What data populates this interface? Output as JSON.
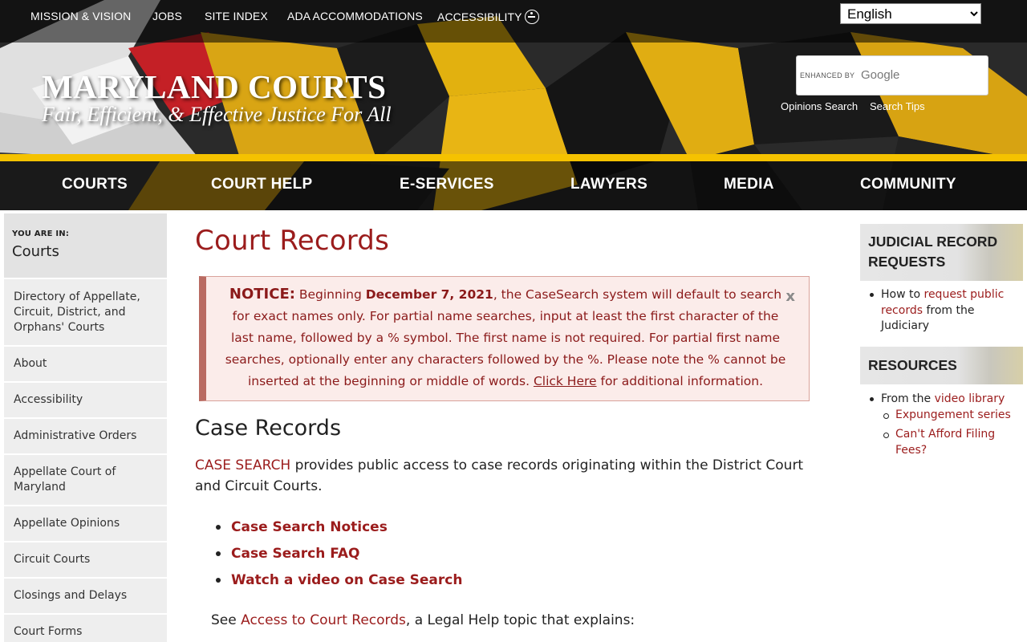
{
  "utility_nav": {
    "mission": "MISSION & VISION",
    "jobs": "JOBS",
    "site_index": "SITE INDEX",
    "ada": "ADA ACCOMMODATIONS",
    "accessibility": "ACCESSIBILITY"
  },
  "language": {
    "selected": "English"
  },
  "brand": {
    "title": "MARYLAND COURTS",
    "tagline": "Fair, Efficient, & Effective Justice For All"
  },
  "search": {
    "enhanced_by": "ENHANCED BY",
    "google": "Google",
    "opinions_link": "Opinions Search",
    "tips_link": "Search Tips"
  },
  "main_nav": [
    "COURTS",
    "COURT HELP",
    "E-SERVICES",
    "LAWYERS",
    "MEDIA",
    "COMMUNITY"
  ],
  "sidebar": {
    "you_are_in_label": "YOU ARE IN:",
    "current": "Courts",
    "items": [
      "Directory of Appellate, Circuit, District, and Orphans' Courts",
      "About",
      "Accessibility",
      "Administrative Orders",
      "Appellate Court of Maryland",
      "Appellate Opinions",
      "Circuit Courts",
      "Closings and Delays",
      "Court Forms"
    ]
  },
  "main": {
    "title": "Court Records",
    "notice": {
      "label": "NOTICE:",
      "text_a": " Beginning ",
      "date": "December 7, 2021",
      "text_b": ", the CaseSearch system will default to search for exact names only. For partial name searches, input at least the first character of the last name, followed by a % symbol. The first name is not required. For partial first name searches, optionally enter any characters followed by the %. Please note the % cannot be inserted at the beginning or middle of words. ",
      "link": "Click Here",
      "text_c": " for additional information.",
      "close": "x"
    },
    "section_heading": "Case Records",
    "intro_link": "CASE SEARCH",
    "intro_text": " provides public access to case records originating within the District Court and Circuit Courts.",
    "links": [
      "Case Search Notices",
      "Case Search FAQ",
      "Watch a video on Case Search"
    ],
    "see_prefix": "See ",
    "see_link": "Access to Court Records",
    "see_suffix": ", a Legal Help topic that explains:"
  },
  "right": {
    "records_heading": "JUDICIAL RECORD REQUESTS",
    "records_text_a": "How to ",
    "records_link": "request public records",
    "records_text_b": " from the Judiciary",
    "resources_heading": "RESOURCES",
    "resources_text": "From the ",
    "resources_link": "video library",
    "sub_links": [
      "Expungement series",
      "Can't Afford Filing Fees?"
    ]
  },
  "colors": {
    "accent_red": "#9b1c1c",
    "flag_gold": "#f5c200",
    "notice_bg": "#fbecea"
  }
}
